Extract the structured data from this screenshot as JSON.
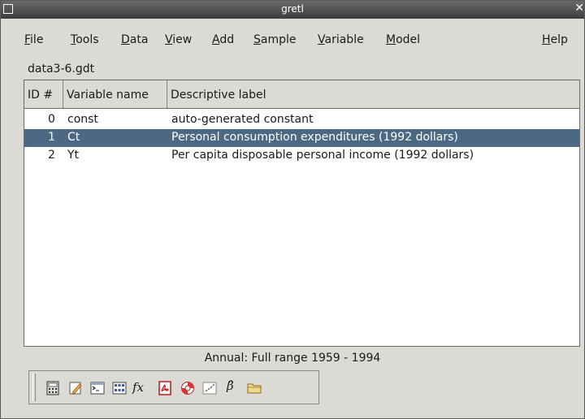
{
  "window": {
    "title": "gretl"
  },
  "menubar": {
    "items": [
      {
        "u": "F",
        "rest": "ile"
      },
      {
        "u": "T",
        "rest": "ools"
      },
      {
        "u": "D",
        "rest": "ata"
      },
      {
        "u": "V",
        "rest": "iew"
      },
      {
        "u": "A",
        "rest": "dd"
      },
      {
        "u": "S",
        "rest": "ample"
      },
      {
        "u": "V",
        "rest": "ariable"
      },
      {
        "u": "M",
        "rest": "odel"
      },
      {
        "u": "H",
        "rest": "elp"
      }
    ]
  },
  "dataset": {
    "filename": "data3-6.gdt"
  },
  "table": {
    "headers": [
      "ID #",
      "Variable name",
      "Descriptive label"
    ],
    "rows": [
      {
        "id": "0",
        "name": "const",
        "label": "auto-generated constant",
        "selected": false
      },
      {
        "id": "1",
        "name": "Ct",
        "label": "Personal consumption expenditures (1992 dollars)",
        "selected": true
      },
      {
        "id": "2",
        "name": "Yt",
        "label": "Per capita disposable personal income (1992 dollars)",
        "selected": false
      }
    ]
  },
  "status": {
    "text": "Annual: Full range 1959 - 1994"
  },
  "toolbar": {
    "icons": [
      "calculator-icon",
      "edit-script-icon",
      "terminal-icon",
      "session-icon-view-icon",
      "function-icon",
      "pdf-help-icon",
      "help-lifebuoy-icon",
      "scatter-plot-icon",
      "beta-hat-icon",
      "open-folder-icon"
    ],
    "fx_text": "fx",
    "beta_text": "β̂"
  }
}
